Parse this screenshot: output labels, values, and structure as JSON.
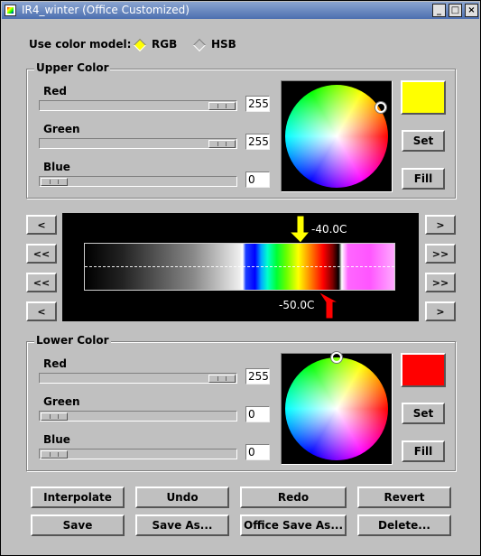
{
  "window": {
    "title": "IR4_winter (Office Customized)",
    "controls": {
      "minimize": "_",
      "maximize": "□",
      "close": "×"
    }
  },
  "color_model": {
    "label": "Use color model:",
    "options": [
      {
        "label": "RGB",
        "selected": true
      },
      {
        "label": "HSB",
        "selected": false
      }
    ]
  },
  "upper_color": {
    "title": "Upper Color",
    "channels": [
      {
        "label": "Red",
        "value": "255",
        "level": 1.0
      },
      {
        "label": "Green",
        "value": "255",
        "level": 1.0
      },
      {
        "label": "Blue",
        "value": "0",
        "level": 0.0
      }
    ],
    "swatch_color": "#ffff00",
    "set_label": "Set",
    "fill_label": "Fill"
  },
  "scale": {
    "upper_marker_label": "-40.0C",
    "upper_marker_color": "#ffff00",
    "lower_marker_label": "-50.0C",
    "lower_marker_color": "#ff0000",
    "left_buttons": [
      "<",
      "<<",
      "<<",
      "<"
    ],
    "right_buttons": [
      ">",
      ">>",
      ">>",
      ">"
    ]
  },
  "lower_color": {
    "title": "Lower Color",
    "channels": [
      {
        "label": "Red",
        "value": "255",
        "level": 1.0
      },
      {
        "label": "Green",
        "value": "0",
        "level": 0.0
      },
      {
        "label": "Blue",
        "value": "0",
        "level": 0.0
      }
    ],
    "swatch_color": "#ff0000",
    "set_label": "Set",
    "fill_label": "Fill"
  },
  "actions": {
    "row1": [
      "Interpolate",
      "Undo",
      "Redo",
      "Revert"
    ],
    "row2": [
      "Save",
      "Save As...",
      "Office Save As...",
      "Delete..."
    ]
  }
}
